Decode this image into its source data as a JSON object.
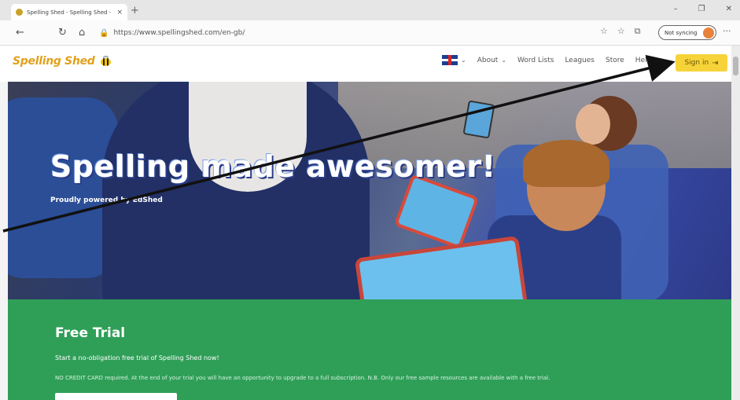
{
  "browser": {
    "tab_title": "Spelling Shed - Spelling Shed - ",
    "tab_close": "×",
    "new_tab": "+",
    "minimize": "–",
    "restore": "❐",
    "close": "✕",
    "back": "←",
    "refresh": "↻",
    "home": "⌂",
    "lock": "🔒",
    "url": "https://www.spellingshed.com/en-gb/",
    "sync_label": "Not syncing",
    "more": "···",
    "icons": [
      "star-icon",
      "favorites-icon",
      "collections-icon"
    ],
    "icon_glyphs": [
      "☆",
      "☆",
      "⧉"
    ]
  },
  "header": {
    "logo_text": "Spelling Shed",
    "nav": [
      {
        "label": "About",
        "has_chevron": true
      },
      {
        "label": "Word Lists",
        "has_chevron": false
      },
      {
        "label": "Leagues",
        "has_chevron": false
      },
      {
        "label": "Store",
        "has_chevron": false
      },
      {
        "label": "Help",
        "has_chevron": false
      }
    ],
    "flag_chevron": "⌄",
    "signin_label": "Sign in",
    "signin_icon": "⇥"
  },
  "hero": {
    "title": "Spelling made awesomer!",
    "subtitle": "Proudly powered by EdShed"
  },
  "trial": {
    "title": "Free Trial",
    "line1": "Start a no-obligation free trial of Spelling Shed now!",
    "line2": "NO CREDIT CARD required. At the end of your trial you will have an opportunity to upgrade to a full subscription. N.B. Only our free sample resources are available with a free trial."
  },
  "colors": {
    "accent_yellow": "#f7d33a",
    "trial_green": "#2f9f58",
    "logo_gold": "#e0a11b"
  }
}
